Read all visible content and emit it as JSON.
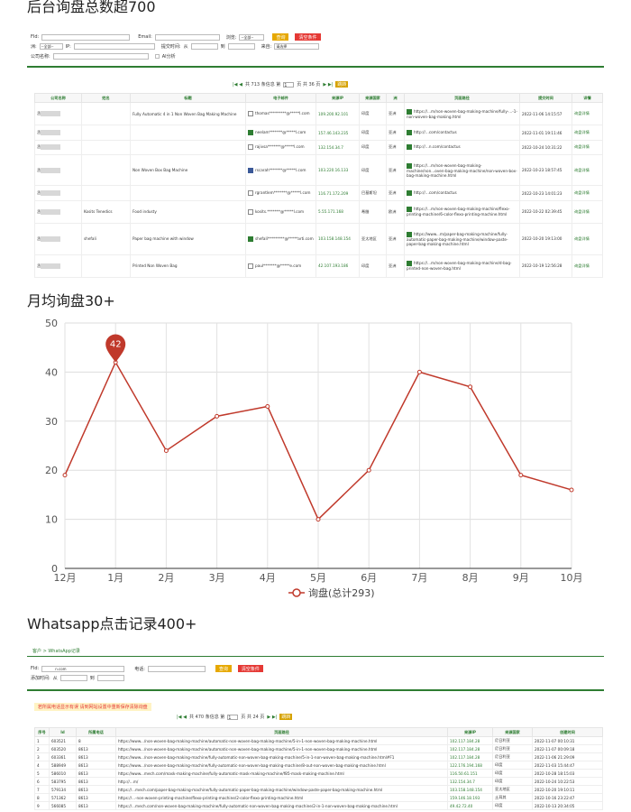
{
  "section1": {
    "title": "后台询盘总数超700"
  },
  "form1": {
    "fid_label": "FId:",
    "email_label": "Email:",
    "browser_label": "浏览:",
    "browser_select": "--全部--",
    "search_btn": "查询",
    "clear_btn": "清空条件",
    "region_label": "洲:",
    "region_select": "--全部--",
    "ip_label": "IP:",
    "submit_time_label": "提交时间:",
    "from_label": "从",
    "to_label": "到",
    "source_label": "来自:",
    "source_select": "请选择",
    "company_label": "公司名称:",
    "ai_label": "AI分析"
  },
  "pager1": {
    "text": "共 713 条信息 第",
    "page": "1",
    "suffix": "页 共 36 页",
    "go": "跳转"
  },
  "table1": {
    "headers": [
      "公司名称",
      "姓名",
      "标题",
      "电子邮件",
      "来源IP",
      "来源国家",
      "洲",
      "页面路径",
      "提交时间",
      "详情"
    ],
    "rows": [
      {
        "company": "丞",
        "name": "",
        "title": "Fully Automatic 4 in 1 Non Woven Bag Making Machine",
        "email": "thomas*********@*****l.com",
        "ip": "109.200.92.101",
        "country": "印度",
        "continent": "亚洲",
        "path": "https://...m/non-woven-bag-making-machine/fully-...-1-non-woven-bag-making.html",
        "time": "2022-11-06 14:15:57",
        "detail": "询盘详情",
        "icon": ""
      },
      {
        "company": "丞",
        "name": "",
        "title": "",
        "email": "neelam*******@*****l.com",
        "ip": "157.46.143.235",
        "country": "印度",
        "continent": "亚洲",
        "path": "http://...com/contactus",
        "time": "2022-11-01 19:11:46",
        "detail": "询盘详情",
        "icon": "in"
      },
      {
        "company": "丞",
        "name": "",
        "title": "",
        "email": "rajivsa*******@*****l.com",
        "ip": "132.154.34.7",
        "country": "印度",
        "continent": "亚洲",
        "path": "http://...n.com/contactus",
        "time": "2022-10-24 10:31:22",
        "detail": "询盘详情",
        "icon": ""
      },
      {
        "company": "丞",
        "name": "",
        "title": "Non Woven Box Bag Machine",
        "email": "rscarah*******@*****l.com",
        "ip": "103.220.16.133",
        "country": "印度",
        "continent": "亚洲",
        "path": "https://...m/non-woven-bag-making-machine/non...oven-bag-making-machine/non-woven-box-bag-making-machine.html",
        "time": "2022-10-23 18:57:45",
        "detail": "询盘详情",
        "icon": "fb"
      },
      {
        "company": "丞",
        "name": "",
        "title": "",
        "email": "rgrantlem*******@*****l.com",
        "ip": "116.71.172.209",
        "country": "巴基斯坦",
        "continent": "亚洲",
        "path": "http://...com/contactus",
        "time": "2022-10-23 14:01:23",
        "detail": "询盘详情",
        "icon": ""
      },
      {
        "company": "丞",
        "name": "Kosits Tenedics",
        "title": "Food industy",
        "email": "kosits.*******@*****l.com",
        "ip": "5.55.171.168",
        "country": "希腊",
        "continent": "欧洲",
        "path": "https://...m/non-woven-bag-making-machine/flexo-printing-machine/6-color-flexo-printing-machine.html",
        "time": "2022-10-22 02:39:45",
        "detail": "询盘详情",
        "icon": ""
      },
      {
        "company": "丞",
        "name": "shefali",
        "title": "Paper bag machine with window",
        "email": "shefali*********@*****arti.com",
        "ip": "103.158.148.154",
        "country": "亚太地区",
        "continent": "亚洲",
        "path": "https://www...m/paper-bag-making-machine/fully-automatic-paper-bag-making-machine/window-paste-paper-bag-making-machine.html",
        "time": "2022-10-20 19:13:00",
        "detail": "询盘详情",
        "icon": "in"
      },
      {
        "company": "丞",
        "name": "",
        "title": "Printed Non Woven Bag",
        "email": "paul*******@*****e.com",
        "ip": "42.107.193.186",
        "country": "印度",
        "continent": "亚洲",
        "path": "https://...m/non-woven-bag-making-machine/d-bag-printed-non-woven-bag.html",
        "time": "2022-10-19 12:56:28",
        "detail": "询盘详情",
        "icon": ""
      }
    ]
  },
  "section2": {
    "title": "月均询盘30+"
  },
  "chart_data": {
    "type": "line",
    "categories": [
      "12月",
      "1月",
      "2月",
      "3月",
      "4月",
      "5月",
      "6月",
      "7月",
      "8月",
      "9月",
      "10月"
    ],
    "series": [
      {
        "name": "询盘(总计293)",
        "values": [
          19,
          42,
          24,
          31,
          33,
          10,
          20,
          40,
          37,
          19,
          16
        ],
        "color": "#c0392b"
      }
    ],
    "ylim": [
      0,
      50
    ],
    "yticks": [
      0,
      10,
      20,
      30,
      40,
      50
    ],
    "max_label": "42",
    "grid": true,
    "legend": "bottom"
  },
  "section3": {
    "title": "Whatsapp点击记录400+"
  },
  "breadcrumb": "客户 > WhatsApp记录",
  "form2": {
    "fid_label": "FId:",
    "fid_value": "n.com",
    "phone_label": "电话:",
    "add_time_label": "添加时间:",
    "from_label": "从",
    "to_label": "到",
    "search_btn": "查询",
    "clear_btn": "清空条件"
  },
  "notice": "若所属电话显示有误 请到网站设置中重新保存清除询盘",
  "pager2": {
    "text": "共 470 条信息 第",
    "page": "1",
    "suffix": "页 共 24 页",
    "go": "跳转"
  },
  "table2": {
    "headers": [
      "序号",
      "Id",
      "所属电话",
      "页面路径",
      "来源IP",
      "来源国家",
      "创建时间"
    ],
    "rows": [
      {
        "n": "1",
        "id": "603521",
        "phone": "8",
        "path": "https://www.../non-woven-bag-making-machine/automatic-non-woven-bag-making-machine/5-in-1-non-woven-bag-making-machine.html",
        "ip": "102.117.184.28",
        "country": "尼日利亚",
        "time": "2022-11-07 00:10:31"
      },
      {
        "n": "2",
        "id": "603520",
        "phone": "8613",
        "path": "https://www.../non-woven-bag-making-machine/automatic-non-woven-bag-making-machine/5-in-1-non-woven-bag-making-machine.html",
        "ip": "102.117.184.28",
        "country": "尼日利亚",
        "time": "2022-11-07 00:09:18"
      },
      {
        "n": "3",
        "id": "603361",
        "phone": "8613",
        "path": "https://www.../non-woven-bag-making-machine/fully-automatic-non-woven-bag-making-machine/5-in-1-non-woven-bag-making-machine.html#F1",
        "ip": "102.117.184.28",
        "country": "尼日利亚",
        "time": "2022-11-06 21:29:09"
      },
      {
        "n": "4",
        "id": "588949",
        "phone": "8613",
        "path": "https://www.../non-woven-bag-making-machine/fully-automatic-non-woven-bag-making-machine/8-out-non-woven-bag-making-machine.html",
        "ip": "122.176.194.168",
        "country": "印度",
        "time": "2022-11-03 15:44:47"
      },
      {
        "n": "5",
        "id": "586010",
        "phone": "8613",
        "path": "https://www...mech.com/mask-making-machine/fully-automatic-mask-making-machine/f85-mask-making-machine.html",
        "ip": "116.50.61.151",
        "country": "印度",
        "time": "2022-10-28 18:15:03"
      },
      {
        "n": "6",
        "id": "583795",
        "phone": "8613",
        "path": "http://...m/",
        "ip": "132.154.34.7",
        "country": "印度",
        "time": "2022-10-24 10:22:53"
      },
      {
        "n": "7",
        "id": "579134",
        "phone": "8613",
        "path": "https://...mech.com/paper-bag-making-machine/fully-automatic-paper-bag-making-machine/window-paste-paper-bag-making-machine.html",
        "ip": "103.158.148.154",
        "country": "亚太地区",
        "time": "2022-10-20 19:10:11"
      },
      {
        "n": "8",
        "id": "571362",
        "phone": "8613",
        "path": "https://...-non-woven-printing-machine/flexo-printing-machine/2-color-flexo-printing-machine.html",
        "ip": "159.146.18.193",
        "country": "土耳其",
        "time": "2022-10-16 23:22:47"
      },
      {
        "n": "9",
        "id": "566085",
        "phone": "8613",
        "path": "https://...mech.com/non-woven-bag-making-machine/fully-automatic-non-woven-bag-making-machine/2-in-1-non-woven-bag-making-machine.html",
        "ip": "49.42.72.40",
        "country": "印度",
        "time": "2022-10-13 20:34:05"
      }
    ]
  }
}
